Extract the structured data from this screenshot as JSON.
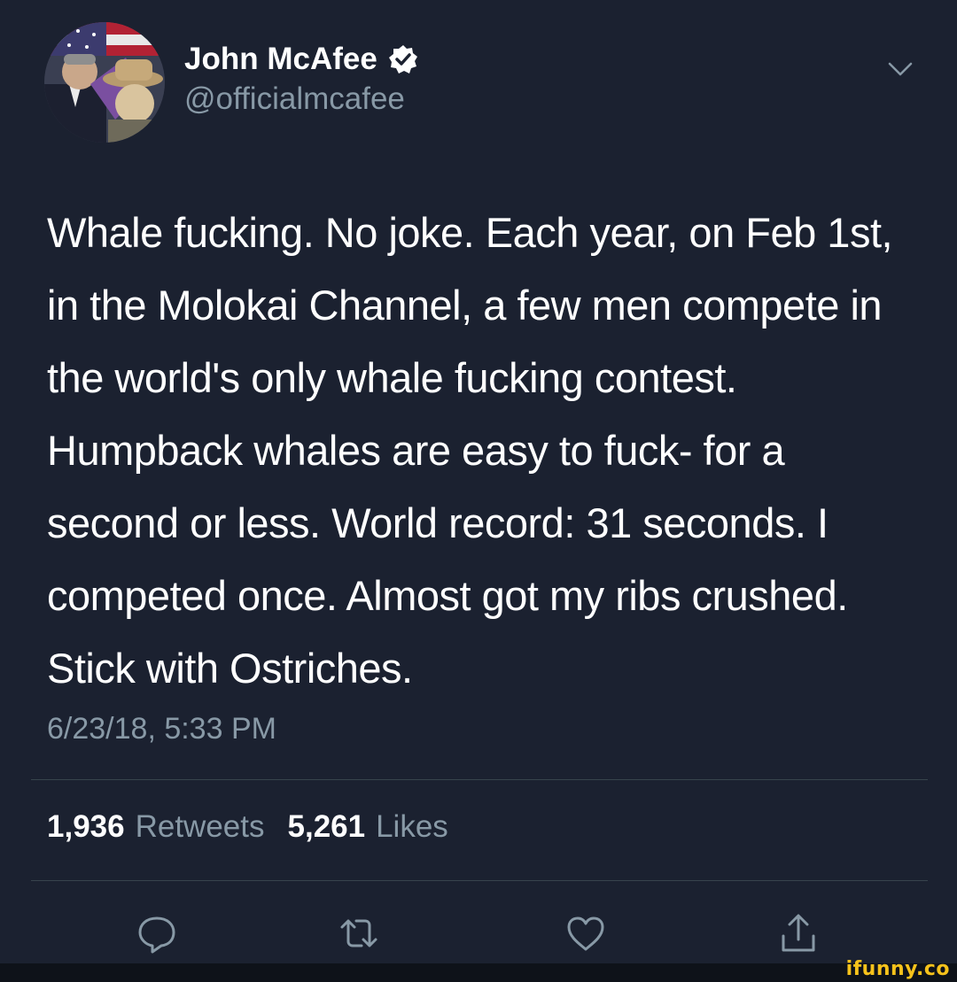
{
  "author": {
    "display_name": "John McAfee",
    "handle": "@officialmcafee",
    "verified_icon": "verified-badge-icon",
    "menu_icon": "chevron-down-icon"
  },
  "tweet": {
    "text": "Whale fucking. No joke. Each year, on Feb 1st, in the Molokai Channel, a few men compete in the world's only whale fucking contest. Humpback whales are easy to fuck- for a second or less. World record: 31 seconds. I competed once. Almost got my ribs crushed. Stick with Ostriches.",
    "timestamp": "6/23/18, 5:33 PM"
  },
  "stats": {
    "retweets_count": "1,936",
    "retweets_label": "Retweets",
    "likes_count": "5,261",
    "likes_label": "Likes"
  },
  "actions": [
    {
      "name": "reply",
      "icon": "reply-icon"
    },
    {
      "name": "retweet",
      "icon": "retweet-icon"
    },
    {
      "name": "like",
      "icon": "heart-icon"
    },
    {
      "name": "share",
      "icon": "share-icon"
    }
  ],
  "watermark": {
    "text": "ifunny.co"
  },
  "colors": {
    "background": "#1b2130",
    "text_primary": "#ffffff",
    "text_secondary": "#8899a6",
    "divider": "#38444d",
    "watermark": "#f6c21b"
  }
}
